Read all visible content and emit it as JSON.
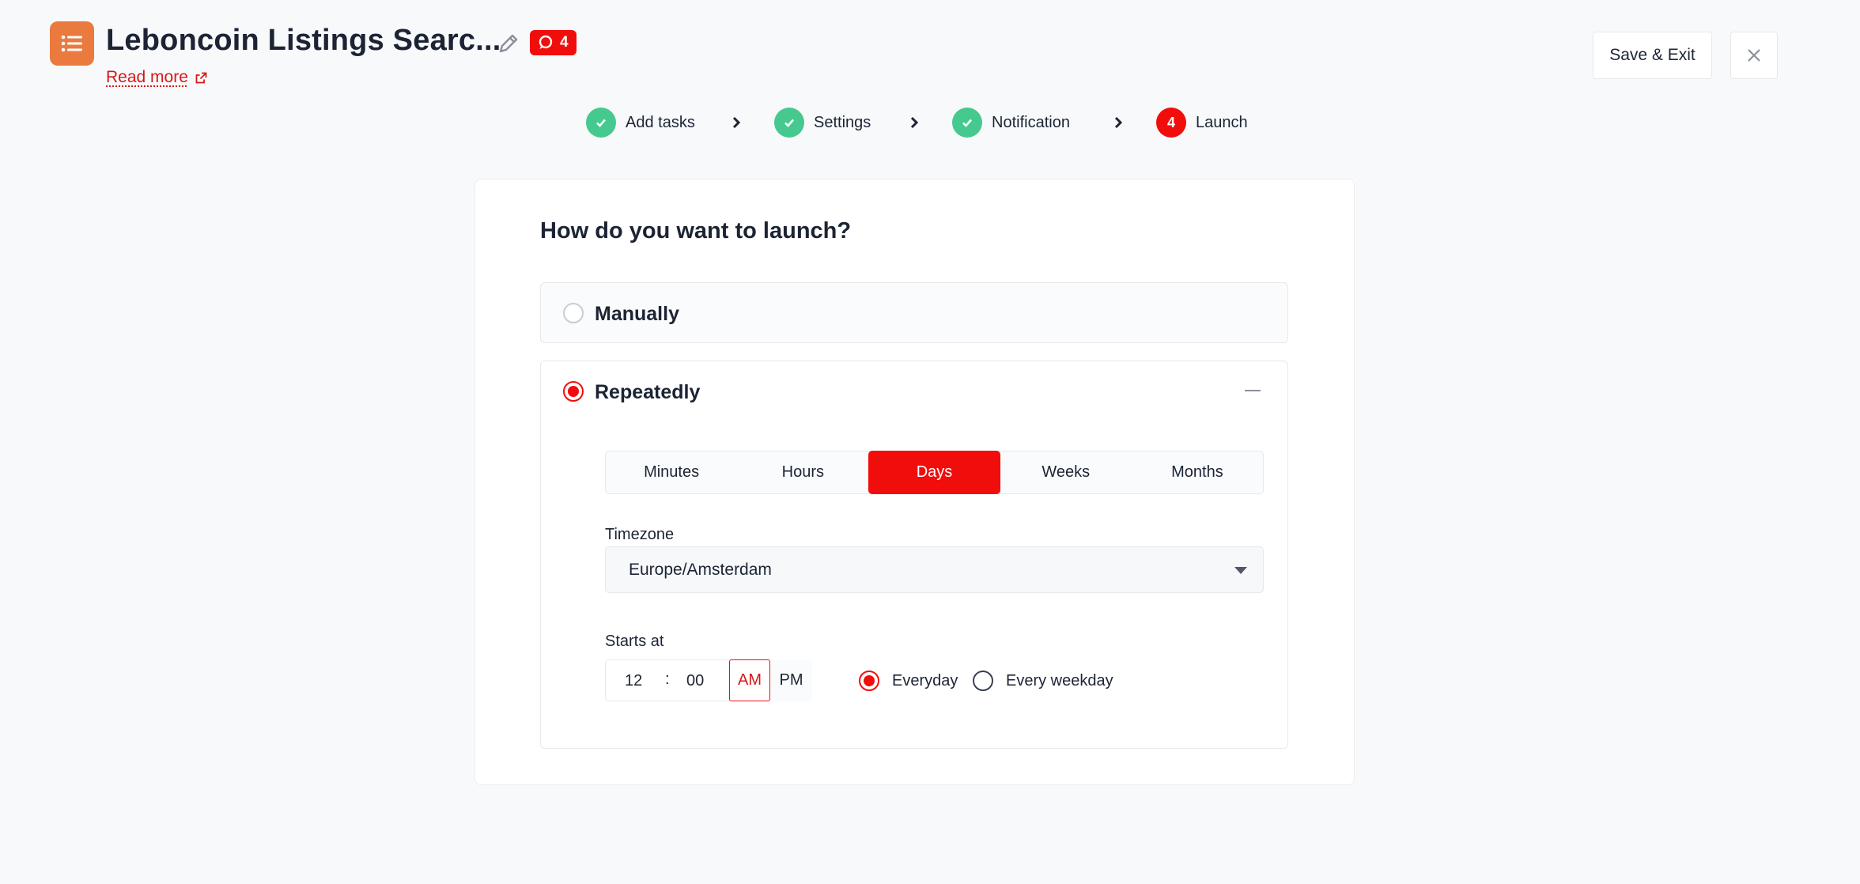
{
  "header": {
    "title": "Leboncoin Listings Searc...",
    "badge_count": "4",
    "read_more": "Read more",
    "save_exit": "Save & Exit"
  },
  "stepper": [
    {
      "label": "Add tasks",
      "state": "done"
    },
    {
      "label": "Settings",
      "state": "done"
    },
    {
      "label": "Notification",
      "state": "done"
    },
    {
      "label": "Launch",
      "state": "active",
      "number": "4"
    }
  ],
  "launch": {
    "question": "How do you want to launch?",
    "options": {
      "manual": "Manually",
      "repeat": "Repeatedly"
    },
    "selected": "repeat",
    "intervals": [
      "Minutes",
      "Hours",
      "Days",
      "Weeks",
      "Months"
    ],
    "selected_interval": "Days",
    "timezone_label": "Timezone",
    "timezone_value": "Europe/Amsterdam",
    "starts_label": "Starts at",
    "hour": "12",
    "sep": ":",
    "minute": "00",
    "am": "AM",
    "pm": "PM",
    "freq": {
      "everyday": "Everyday",
      "weekday": "Every weekday",
      "selected": "everyday"
    }
  },
  "colors": {
    "accent": "#f20d0d",
    "done": "#46c98f",
    "app_icon": "#ea7a3d"
  }
}
